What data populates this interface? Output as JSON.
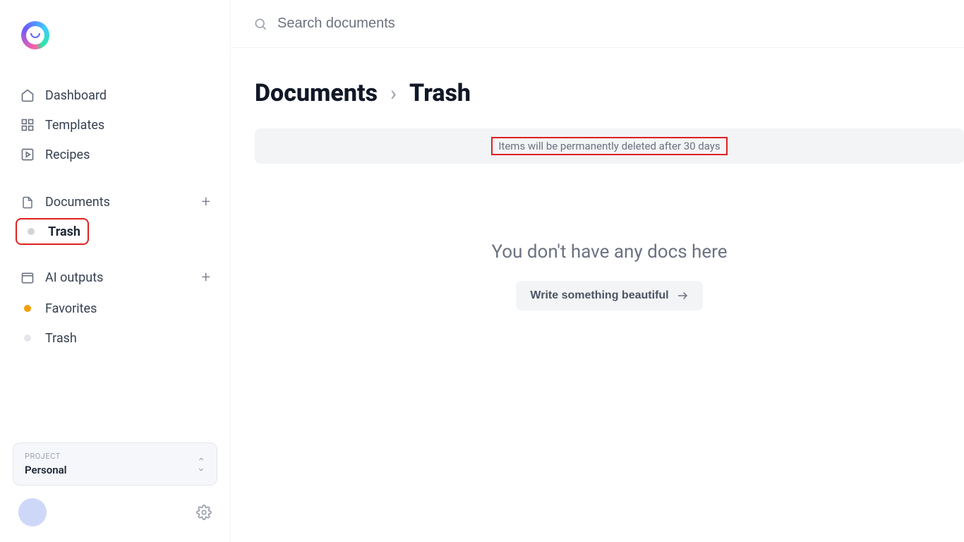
{
  "search": {
    "placeholder": "Search documents"
  },
  "sidebar": {
    "items": [
      {
        "id": "dashboard",
        "label": "Dashboard"
      },
      {
        "id": "templates",
        "label": "Templates"
      },
      {
        "id": "recipes",
        "label": "Recipes"
      },
      {
        "id": "documents",
        "label": "Documents"
      },
      {
        "id": "trash",
        "label": "Trash"
      },
      {
        "id": "ai-outputs",
        "label": "AI outputs"
      },
      {
        "id": "favorites",
        "label": "Favorites"
      },
      {
        "id": "trash2",
        "label": "Trash"
      }
    ],
    "project": {
      "caption": "PROJECT",
      "value": "Personal"
    }
  },
  "breadcrumb": {
    "root": "Documents",
    "leaf": "Trash"
  },
  "banner": {
    "text": "Items will be permanently deleted after 30 days"
  },
  "empty": {
    "title": "You don't have any docs here",
    "cta": "Write something beautiful"
  }
}
